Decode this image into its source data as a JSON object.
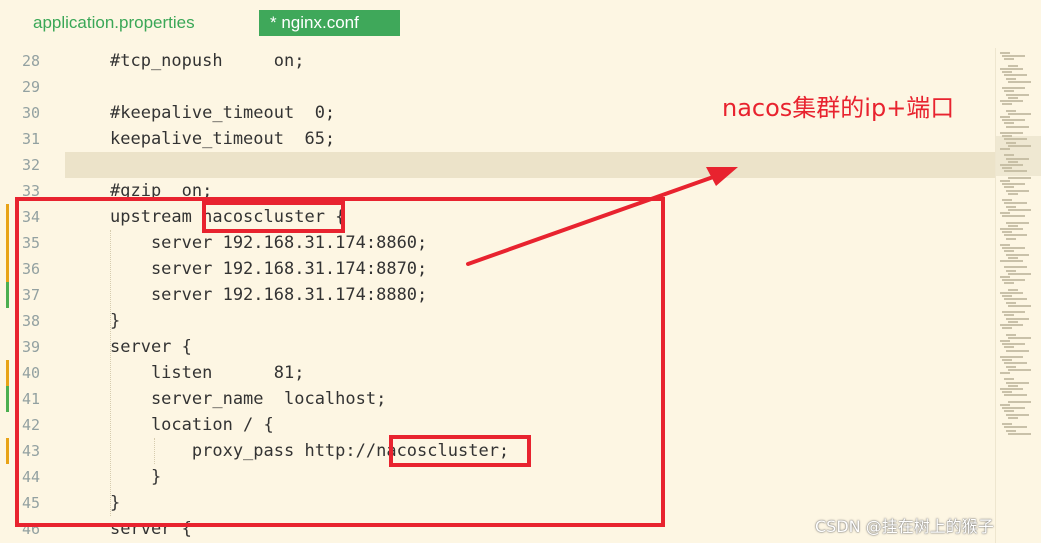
{
  "tabs": [
    {
      "label": "application.properties",
      "active": false
    },
    {
      "label": "* nginx.conf",
      "active": true
    }
  ],
  "code_lines": [
    {
      "num": "28",
      "text": "#tcp_nopush     on;"
    },
    {
      "num": "29",
      "text": ""
    },
    {
      "num": "30",
      "text": "#keepalive_timeout  0;"
    },
    {
      "num": "31",
      "text": "keepalive_timeout  65;"
    },
    {
      "num": "32",
      "text": "",
      "current": true
    },
    {
      "num": "33",
      "text": "#gzip  on;"
    },
    {
      "num": "34",
      "text": "upstream nacoscluster {",
      "change": "modified"
    },
    {
      "num": "35",
      "text": "    server 192.168.31.174:8860;",
      "change": "modified"
    },
    {
      "num": "36",
      "text": "    server 192.168.31.174:8870;",
      "change": "modified"
    },
    {
      "num": "37",
      "text": "    server 192.168.31.174:8880;",
      "change": "added"
    },
    {
      "num": "38",
      "text": "}"
    },
    {
      "num": "39",
      "text": "server {"
    },
    {
      "num": "40",
      "text": "    listen      81;",
      "change": "modified"
    },
    {
      "num": "41",
      "text": "    server_name  localhost;",
      "change": "added"
    },
    {
      "num": "42",
      "text": "    location / {"
    },
    {
      "num": "43",
      "text": "        proxy_pass http://nacoscluster;",
      "change": "modified"
    },
    {
      "num": "44",
      "text": "    }"
    },
    {
      "num": "45",
      "text": "}"
    },
    {
      "num": "46",
      "text": "server {"
    }
  ],
  "annotation": "nacos集群的ip+端口",
  "watermark": "CSDN @挂在树上的猴子",
  "colors": {
    "background": "#fdf6e3",
    "current_line": "#ece3c9",
    "tab_active": "#3fa85a",
    "tab_inactive_text": "#3aa757",
    "highlight_red": "#e8232f",
    "change_modified": "#e8a317",
    "change_added": "#4caf50"
  }
}
